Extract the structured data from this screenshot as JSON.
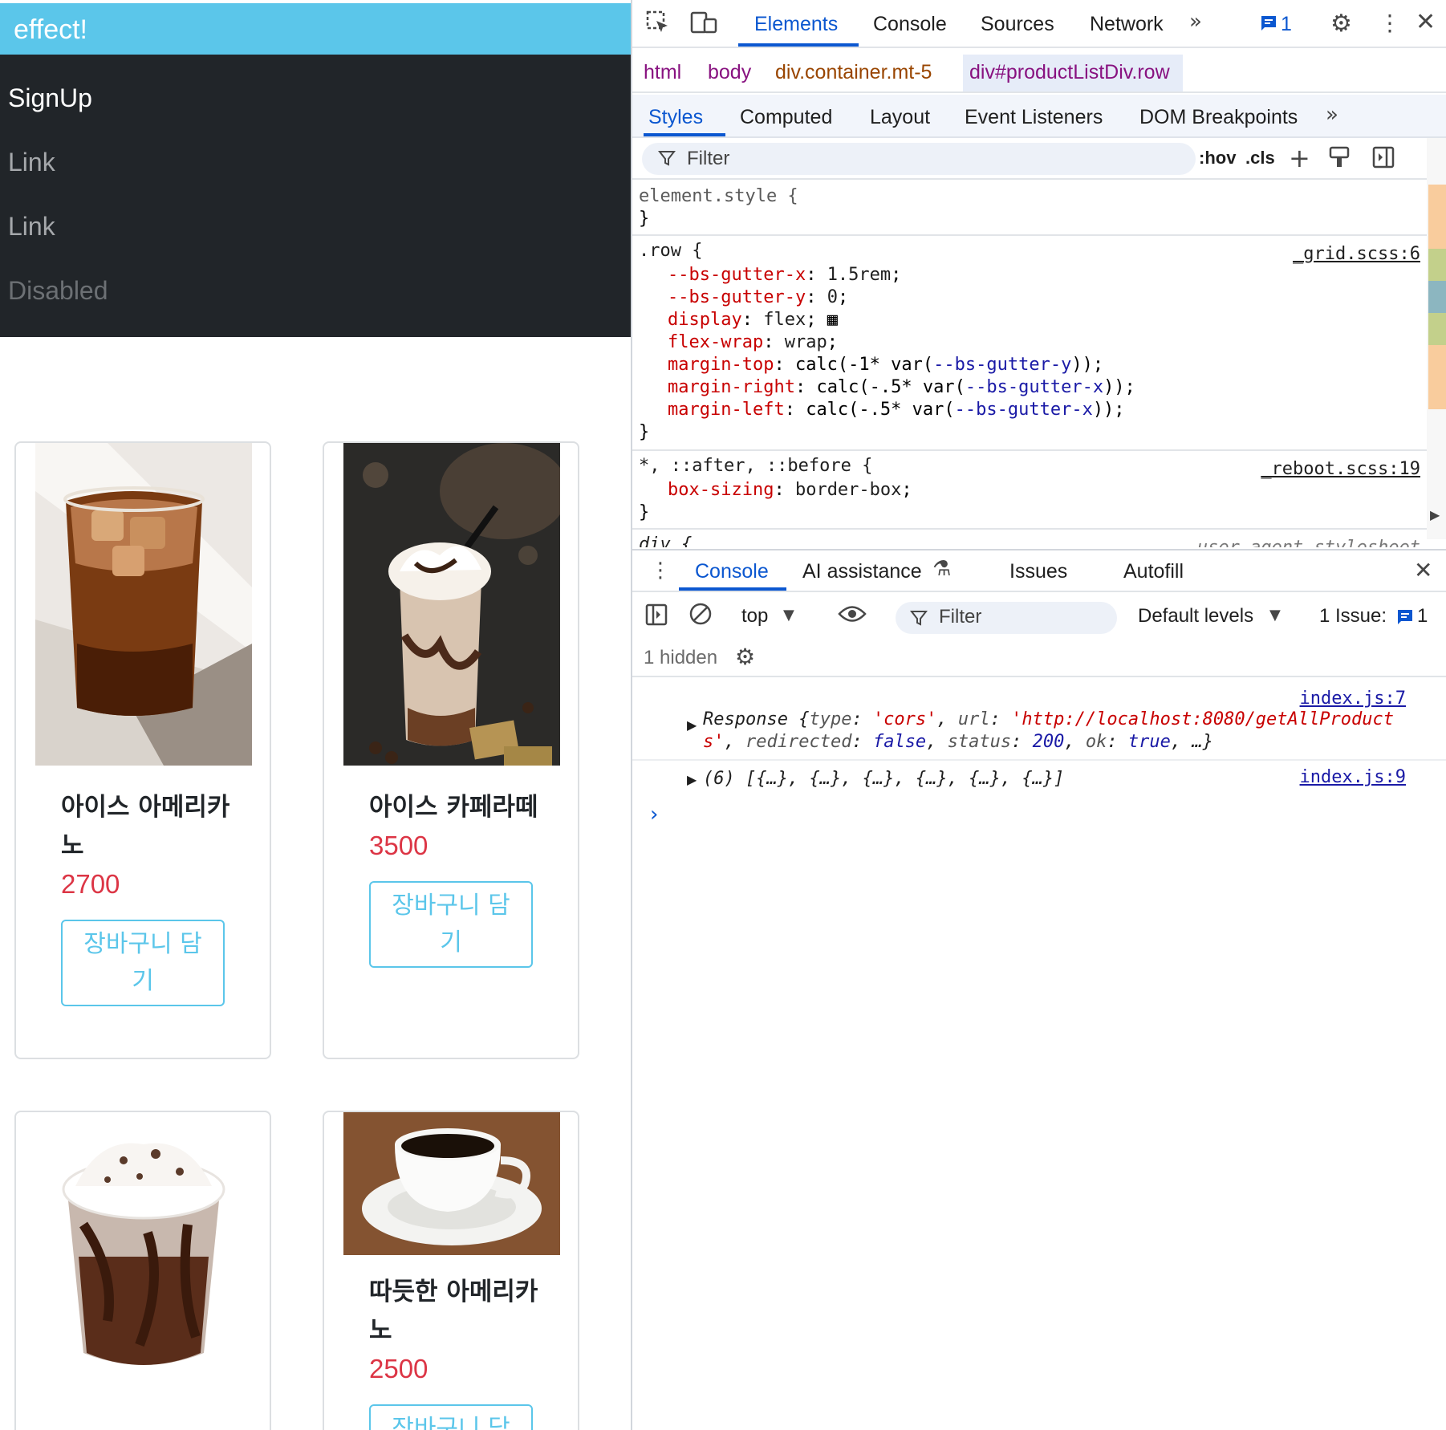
{
  "page": {
    "brand": "effect!",
    "nav": {
      "signup": "SignUp",
      "link1": "Link",
      "link2": "Link",
      "disabled": "Disabled"
    },
    "products": [
      {
        "name": "아이스 아메리카노",
        "price": "2700",
        "button": "장바구니 담기"
      },
      {
        "name": "아이스 카페라떼",
        "price": "3500",
        "button": "장바구니 담기"
      },
      {
        "name": "",
        "price": "",
        "button": ""
      },
      {
        "name": "따듯한 아메리카노",
        "price": "2500",
        "button": "장바구니 담기"
      }
    ]
  },
  "devtools": {
    "tabs": [
      "Elements",
      "Console",
      "Sources",
      "Network"
    ],
    "issues_count": "1",
    "breadcrumb": [
      "html",
      "body",
      "div.container.mt-5",
      "div#productListDiv.row"
    ],
    "styles_tabs": [
      "Styles",
      "Computed",
      "Layout",
      "Event Listeners",
      "DOM Breakpoints"
    ],
    "filter_placeholder": "Filter",
    "hov": ":hov",
    "cls": ".cls",
    "rules": {
      "element_style": "element.style {",
      "row_selector": ".row {",
      "row_source": "_grid.scss:6",
      "reboot_selector": "*, ::after, ::before {",
      "reboot_source": "_reboot.scss:19",
      "div_selector": "div {",
      "div_source": "user agent stylesheet"
    },
    "drawer": {
      "tabs": [
        "Console",
        "AI assistance",
        "Issues",
        "Autofill"
      ],
      "context": "top",
      "filter": "Filter",
      "levels": "Default levels",
      "issues_label": "1 Issue:",
      "issues_count": "1",
      "hidden": "1 hidden",
      "logs": [
        {
          "source": "index.js:7"
        },
        {
          "source": "index.js:9",
          "text": "(6) [{…}, {…}, {…}, {…}, {…}, {…}]"
        }
      ]
    }
  }
}
